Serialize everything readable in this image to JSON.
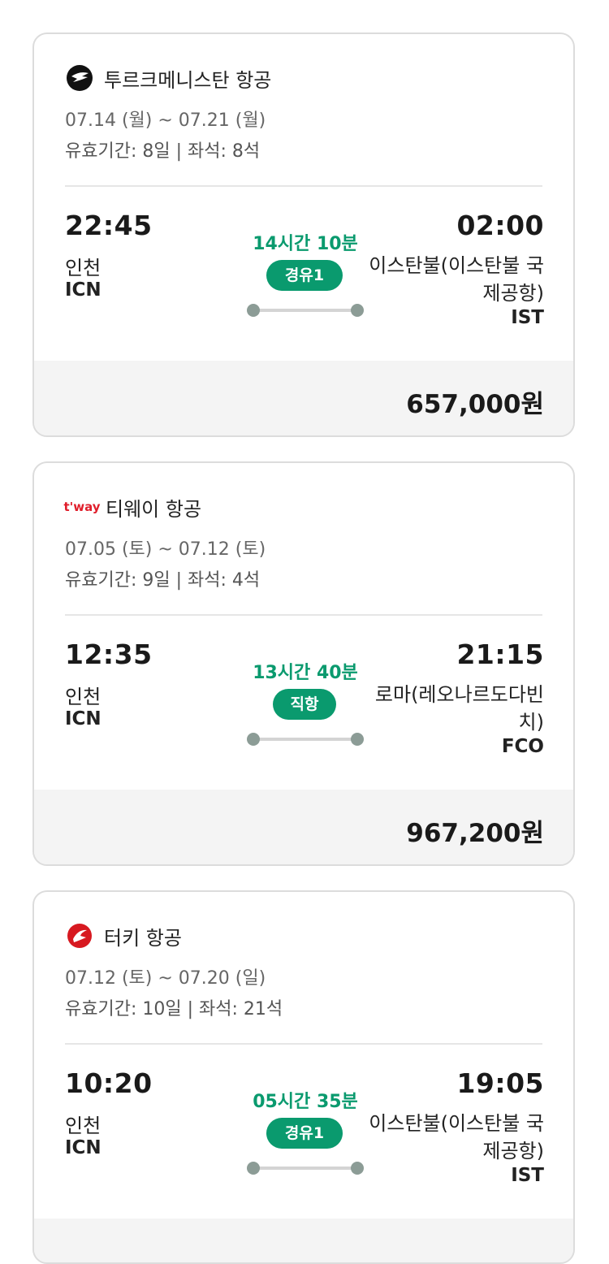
{
  "flights": [
    {
      "airline": "투르크메니스탄 항공",
      "logo_icon": "turkmenistan-airlines-logo",
      "dates": "07.14 (월) ~ 07.21 (월)",
      "validity": "유효기간: 8일 | 좌석: 8석",
      "departure": {
        "time": "22:45",
        "city": "인천",
        "code": "ICN"
      },
      "duration": "14시간 10분",
      "stop_label": "경유1",
      "arrival": {
        "time": "02:00",
        "city": "이스탄불(이스탄불 국제공항)",
        "code": "IST"
      },
      "price": "657,000원"
    },
    {
      "airline": "티웨이 항공",
      "logo_icon": "tway-logo",
      "dates": "07.05 (토) ~ 07.12 (토)",
      "validity": "유효기간: 9일 | 좌석: 4석",
      "departure": {
        "time": "12:35",
        "city": "인천",
        "code": "ICN"
      },
      "duration": "13시간 40분",
      "stop_label": "직항",
      "arrival": {
        "time": "21:15",
        "city": "로마(레오나르도다빈치)",
        "code": "FCO"
      },
      "price": "967,200원"
    },
    {
      "airline": "터키 항공",
      "logo_icon": "turkish-airlines-logo",
      "dates": "07.12 (토) ~ 07.20 (일)",
      "validity": "유효기간: 10일 | 좌석: 21석",
      "departure": {
        "time": "10:20",
        "city": "인천",
        "code": "ICN"
      },
      "duration": "05시간 35분",
      "stop_label": "경유1",
      "arrival": {
        "time": "19:05",
        "city": "이스탄불(이스탄불 국제공항)",
        "code": "IST"
      },
      "price": ""
    }
  ],
  "logo_text": {
    "tway": "t'way"
  },
  "colors": {
    "accent": "#0a9a6e",
    "route_dot": "#8c9c96",
    "price_bg": "#f4f4f4",
    "turkish_red": "#d71920"
  }
}
